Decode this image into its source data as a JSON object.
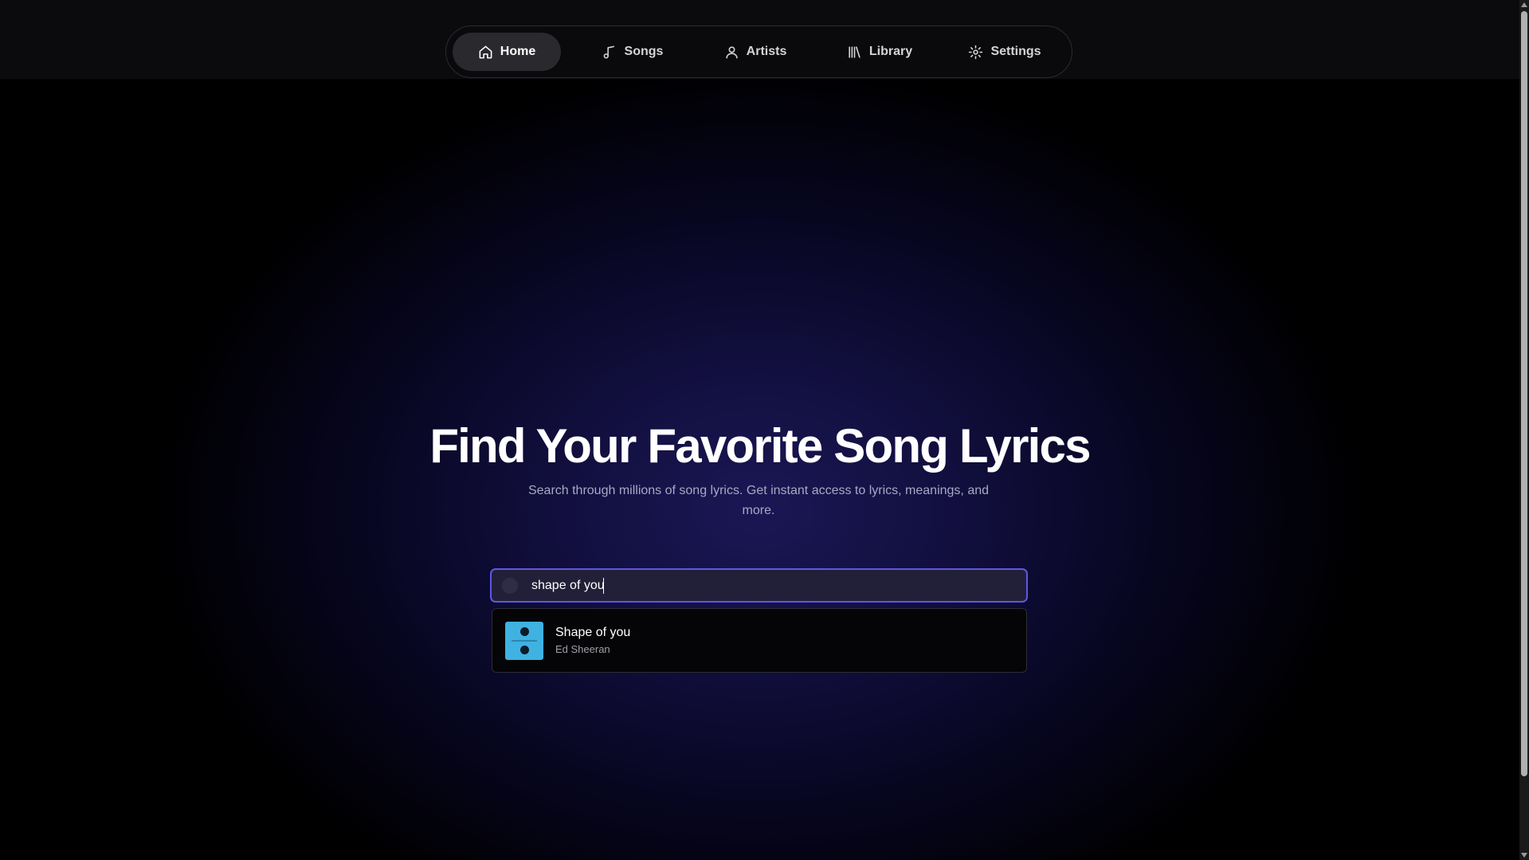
{
  "nav": {
    "items": [
      {
        "label": "Home",
        "icon": "home-icon",
        "active": true
      },
      {
        "label": "Songs",
        "icon": "music-note-icon",
        "active": false
      },
      {
        "label": "Artists",
        "icon": "user-icon",
        "active": false
      },
      {
        "label": "Library",
        "icon": "library-icon",
        "active": false
      },
      {
        "label": "Settings",
        "icon": "gear-icon",
        "active": false
      }
    ]
  },
  "hero": {
    "title": "Find Your Favorite Song Lyrics",
    "subtitle": "Search through millions of song lyrics. Get instant access to lyrics, meanings, and more."
  },
  "search": {
    "value": "shape of you"
  },
  "results": [
    {
      "title": "Shape of you",
      "artist": "Ed Sheeran"
    }
  ],
  "colors": {
    "accent": "#6056e6",
    "album_art": "#3fb2e2"
  }
}
